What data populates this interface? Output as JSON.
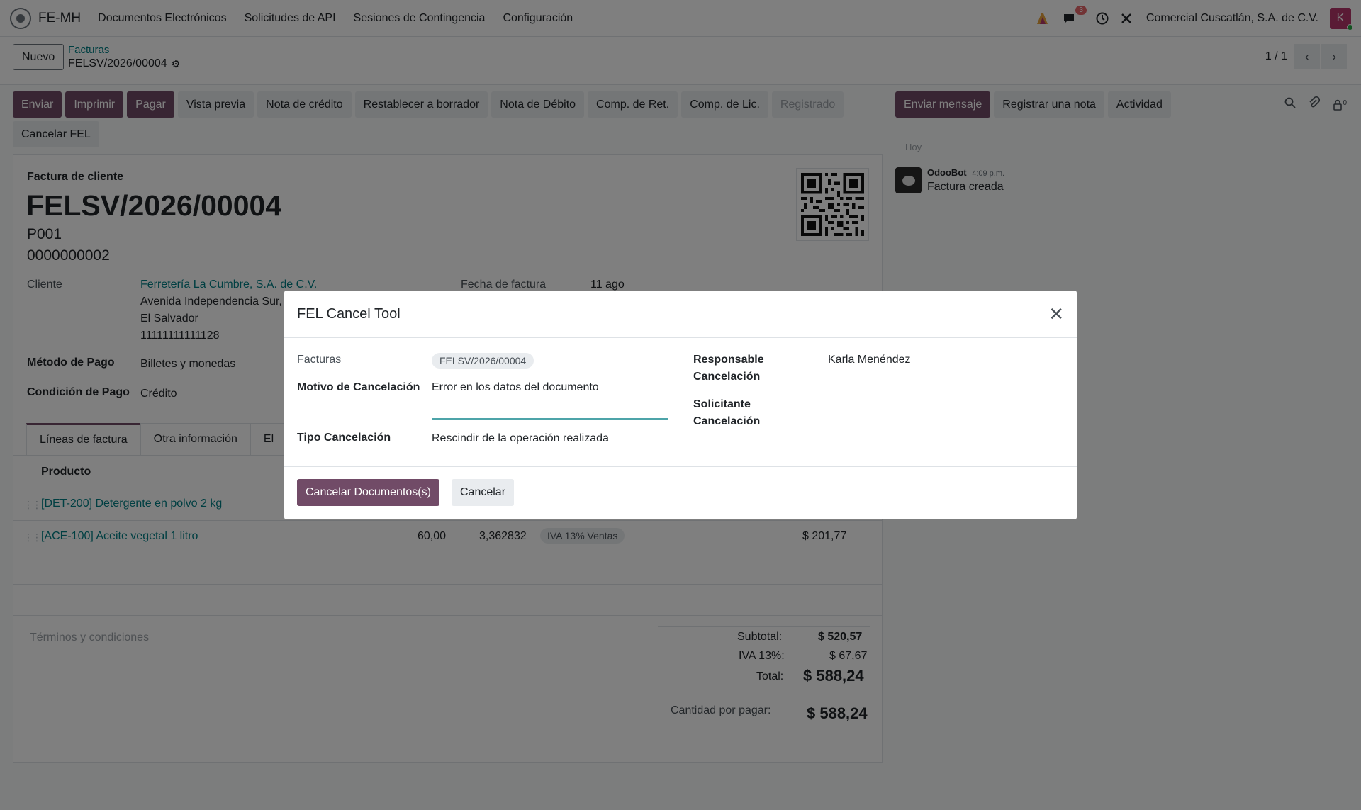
{
  "topnav": {
    "brand": "FE-MH",
    "menu": [
      "Documentos Electrónicos",
      "Solicitudes de API",
      "Sesiones de Contingencia",
      "Configuración"
    ],
    "messages_count": "3",
    "company": "Comercial Cuscatlán, S.A. de C.V.",
    "avatar_letter": "K"
  },
  "control": {
    "new_label": "Nuevo",
    "breadcrumb_parent": "Facturas",
    "breadcrumb_current": "FELSV/2026/00004",
    "pager": "1 / 1"
  },
  "actions": {
    "row1": [
      "Enviar",
      "Imprimir",
      "Pagar",
      "Vista previa",
      "Nota de crédito",
      "Restablecer a borrador",
      "Nota de Débito",
      "Comp. de Ret.",
      "Comp. de Lic.",
      "Registrado"
    ],
    "row2": [
      "Cancelar FEL"
    ]
  },
  "chatter": {
    "send_message": "Enviar mensaje",
    "log_note": "Registrar una nota",
    "activity": "Actividad",
    "followers_count": "0",
    "separator": "Hoy",
    "author": "OdooBot",
    "time": "4:09 p.m.",
    "body": "Factura creada"
  },
  "form": {
    "doc_type": "Factura de cliente",
    "name": "FELSV/2026/00004",
    "line1": "P001",
    "line2": "0000000002",
    "customer_label": "Cliente",
    "customer_name": "Ferretería La Cumbre, S.A. de C.V.",
    "customer_addr1": "Avenida Independencia Sur,",
    "customer_addr2": "El Salvador",
    "customer_addr3": "11111111111128",
    "invoice_date_label": "Fecha de factura",
    "invoice_date": "11 ago",
    "payment_method_label": "Método de Pago",
    "payment_method": "Billetes y monedas",
    "payment_cond_label": "Condición de Pago",
    "payment_cond": "Crédito",
    "tabs": [
      "Líneas de factura",
      "Otra información",
      "El"
    ],
    "col_product": "Producto",
    "lines": [
      {
        "product": "[DET-200] Detergente en polvo 2 kg",
        "qty": "",
        "price": "",
        "tax": "",
        "amount": ""
      },
      {
        "product": "[ACE-100] Aceite vegetal 1 litro",
        "qty": "60,00",
        "price": "3,362832",
        "tax": "IVA 13% Ventas",
        "amount": "$ 201,77"
      }
    ],
    "terms": "Términos y condiciones",
    "subtotal_label": "Subtotal:",
    "subtotal": "$ 520,57",
    "iva_label": "IVA 13%:",
    "iva": "$ 67,67",
    "total_label": "Total:",
    "total": "$ 588,24",
    "due_label": "Cantidad por pagar:",
    "due": "$ 588,24"
  },
  "modal": {
    "title": "FEL Cancel Tool",
    "invoices_label": "Facturas",
    "invoice_chip": "FELSV/2026/00004",
    "reason_label": "Motivo de Cancelación",
    "reason_value": "Error en los datos del documento",
    "type_label": "Tipo Cancelación",
    "type_value": "Rescindir de la operación realizada",
    "responsible_label_1": "Responsable",
    "responsible_label_2": "Cancelación",
    "responsible_value": "Karla Menéndez",
    "requester_label_1": "Solicitante",
    "requester_label_2": "Cancelación",
    "confirm_button": "Cancelar Documentos(s)",
    "cancel_button": "Cancelar"
  },
  "colors": {
    "primary": "#714b67",
    "link": "#017e84",
    "badge": "#e4666a"
  }
}
